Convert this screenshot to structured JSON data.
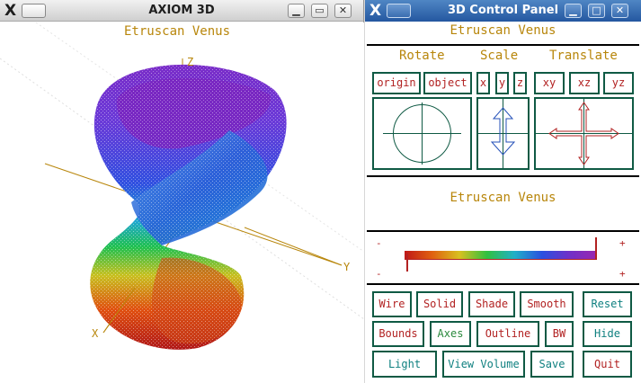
{
  "left_window": {
    "title": "AXIOM 3D",
    "logo": "X",
    "viewport": {
      "title": "Etruscan Venus",
      "axis_labels": {
        "x": "X",
        "y": "Y",
        "z": "Z"
      }
    }
  },
  "right_window": {
    "title": "3D Control Panel",
    "logo": "X",
    "panel_title": "Etruscan Venus",
    "headers": {
      "rotate": "Rotate",
      "scale": "Scale",
      "translate": "Translate"
    },
    "rotate_buttons": [
      "origin",
      "object"
    ],
    "scale_buttons": [
      "x",
      "y",
      "z"
    ],
    "translate_buttons": [
      "xy",
      "xz",
      "yz"
    ],
    "message": "Etruscan Venus",
    "colormap": {
      "minus_top": "-",
      "plus_top": "+",
      "minus_bottom": "-",
      "plus_bottom": "+"
    },
    "buttons": {
      "wire": "Wire",
      "solid": "Solid",
      "shade": "Shade",
      "smooth": "Smooth",
      "reset": "Reset",
      "bounds": "Bounds",
      "axes": "Axes",
      "outline": "Outline",
      "bw": "BW",
      "hide": "Hide",
      "light": "Light",
      "view_volume": "View Volume",
      "save": "Save",
      "quit": "Quit"
    }
  },
  "titlebar_icons": {
    "minimize": "minimize-icon",
    "maximize": "maximize-icon",
    "close": "close-icon"
  },
  "glyphs": {
    "minimize": "▁",
    "restore": "▭",
    "close": "✕",
    "maximize": "□"
  },
  "colors": {
    "active_titlebar": "#2457a0",
    "panel_border": "#0f5a44",
    "panel_text": "#b8860b",
    "button_red": "#b22222",
    "button_teal": "#0f8080",
    "button_green": "#2b8a3e"
  }
}
